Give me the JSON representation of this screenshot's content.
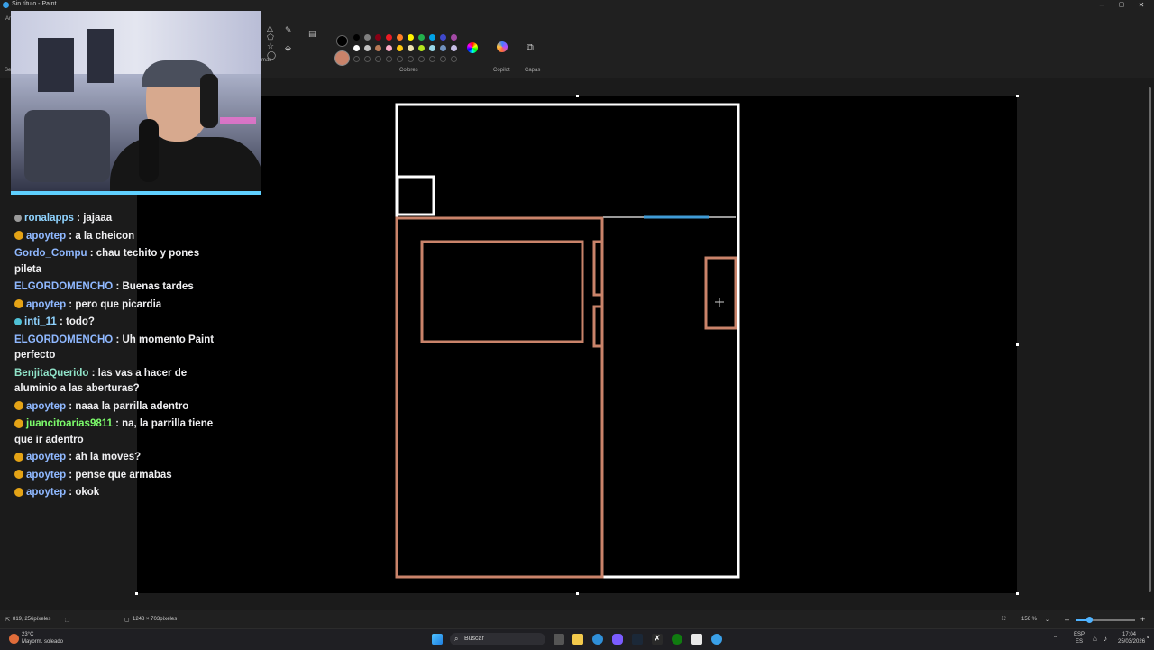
{
  "window": {
    "title": "Sin título - Paint",
    "minimize": "–",
    "maximize": "▢",
    "close": "✕"
  },
  "ribbon": {
    "left_fragments": [
      "Ar",
      "Sel"
    ],
    "tools_label": "rmas",
    "colors_label": "Colores",
    "copilot_label": "Copilot",
    "layers_label": "Capas",
    "primary_color": "#000000",
    "secondary_color": "#c9836a",
    "palette": [
      [
        "#000000",
        "#7f7f7f",
        "#880015",
        "#ed1c24",
        "#ff7f27",
        "#fff200",
        "#22b14c",
        "#00a2e8",
        "#3f48cc",
        "#a349a4"
      ],
      [
        "#ffffff",
        "#c3c3c3",
        "#b97a57",
        "#ffaec9",
        "#ffc90e",
        "#efe4b0",
        "#b5e61d",
        "#99d9ea",
        "#7092be",
        "#c8bfe7"
      ]
    ]
  },
  "chat": {
    "messages": [
      {
        "user": "ronalapps",
        "text": ": jajaaa",
        "user_color": "#8fd3ff",
        "badge": "#9a9a9a"
      },
      {
        "user": "apoytep",
        "text": ": a la cheicon",
        "user_color": "#8fb8ff",
        "badge": "gold"
      },
      {
        "user": "Gordo_Compu",
        "text": ": chau techito y pones pileta",
        "user_color": "#8fb8ff",
        "badge": ""
      },
      {
        "user": "ELGORDOMENCHO",
        "text": ": Buenas tardes",
        "user_color": "#8fb8ff",
        "badge": ""
      },
      {
        "user": "apoytep",
        "text": ": pero que picardia",
        "user_color": "#8fb8ff",
        "badge": "gold"
      },
      {
        "user": "inti_11",
        "text": ": todo?",
        "user_color": "#8fd3ff",
        "badge": "#4fc1d6"
      },
      {
        "user": "ELGORDOMENCHO",
        "text": ": Uh momento Paint perfecto",
        "user_color": "#8fb8ff",
        "badge": ""
      },
      {
        "user": "BenjitaQuerido",
        "text": ": las vas a hacer de aluminio a las aberturas?",
        "user_color": "#8fe3c8",
        "badge": ""
      },
      {
        "user": "apoytep",
        "text": ": naaa la parrilla adentro",
        "user_color": "#8fb8ff",
        "badge": "gold"
      },
      {
        "user": "juancitoarias9811",
        "text": ": na, la parrilla tiene que ir adentro",
        "user_color": "#7cfc6b",
        "badge": "gold"
      },
      {
        "user": "apoytep",
        "text": ": ah la moves?",
        "user_color": "#8fb8ff",
        "badge": "gold"
      },
      {
        "user": "apoytep",
        "text": ": pense que armabas",
        "user_color": "#8fb8ff",
        "badge": "gold"
      },
      {
        "user": "apoytep",
        "text": ": okok",
        "user_color": "#8fb8ff",
        "badge": "gold"
      }
    ]
  },
  "status": {
    "cursor_pos": "819, 256píxeles",
    "canvas_size": "1248 × 703píxeles",
    "zoom": "156 %",
    "zoom_level": 0.23,
    "zoom_down": "–",
    "zoom_up": "+"
  },
  "taskbar": {
    "weather_temp": "23°C",
    "weather_desc": "Mayorm. soleado",
    "search_placeholder": "Buscar",
    "lang_1": "ESP",
    "lang_2": "ES",
    "time": "17:04",
    "date": "25/03/2026"
  }
}
